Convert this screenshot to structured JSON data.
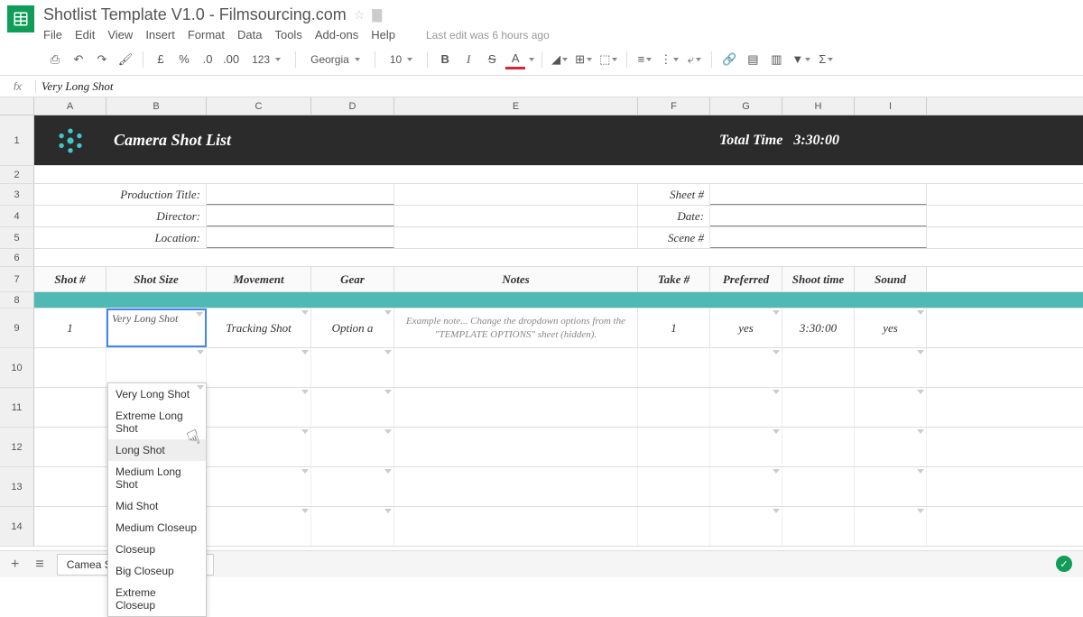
{
  "doc_title": "Shotlist Template V1.0 - Filmsourcing.com",
  "last_edit": "Last edit was 6 hours ago",
  "menu": {
    "file": "File",
    "edit": "Edit",
    "view": "View",
    "insert": "Insert",
    "format": "Format",
    "data": "Data",
    "tools": "Tools",
    "addons": "Add-ons",
    "help": "Help"
  },
  "toolbar": {
    "currency": "£",
    "percent": "%",
    "dec1": ".0",
    "dec2": ".00",
    "num": "123",
    "font": "Georgia",
    "fontsize": "10",
    "bold": "B",
    "italic": "I",
    "strike": "S",
    "textcolor": "A"
  },
  "formula": {
    "fx": "fx",
    "value": "Very Long Shot"
  },
  "columns": [
    "A",
    "B",
    "C",
    "D",
    "E",
    "F",
    "G",
    "H",
    "I"
  ],
  "header": {
    "title": "Camera Shot List",
    "total_label": "Total Time",
    "total_value": "3:30:00"
  },
  "form": {
    "production": "Production Title:",
    "director": "Director:",
    "location": "Location:",
    "sheet": "Sheet #",
    "date": "Date:",
    "scene": "Scene #"
  },
  "th": {
    "shotnum": "Shot #",
    "shotsize": "Shot Size",
    "movement": "Movement",
    "gear": "Gear",
    "notes": "Notes",
    "take": "Take #",
    "preferred": "Preferred",
    "shoottime": "Shoot time",
    "sound": "Sound"
  },
  "row9": {
    "shotnum": "1",
    "shotsize_input": "Very Long Shot",
    "movement": "Tracking Shot",
    "gear": "Option a",
    "notes": "Example note... Change the dropdown options from the \"TEMPLATE OPTIONS\" sheet (hidden).",
    "take": "1",
    "preferred": "yes",
    "shoottime": "3:30:00",
    "sound": "yes"
  },
  "dropdown": [
    "Very Long Shot",
    "Extreme Long Shot",
    "Long Shot",
    "Medium Long Shot",
    "Mid Shot",
    "Medium Closeup",
    "Closeup",
    "Big Closeup",
    "Extreme Closeup"
  ],
  "dropdown_hover_index": 2,
  "sheet_tab": "Camea Shot List Template"
}
